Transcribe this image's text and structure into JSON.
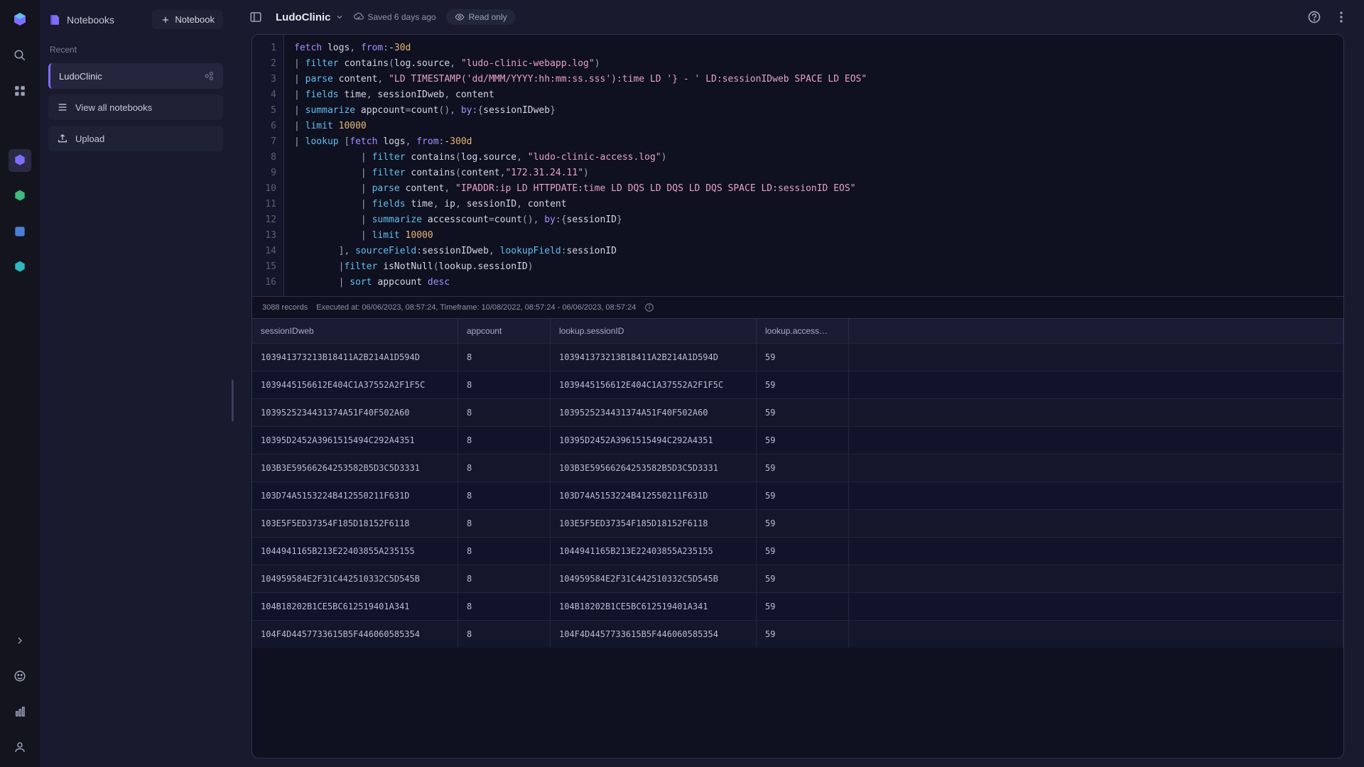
{
  "rail": {
    "items": [
      "logo",
      "search",
      "apps",
      "gap",
      "cube-purple",
      "cube-green",
      "app-blue",
      "hex-teal"
    ],
    "bottom": [
      "expand",
      "smiley",
      "bars",
      "user"
    ]
  },
  "sidebar": {
    "notebooks_label": "Notebooks",
    "new_notebook_label": "Notebook",
    "recent_label": "Recent",
    "current_notebook": "LudoClinic",
    "actions": {
      "view_all": "View all notebooks",
      "upload": "Upload"
    }
  },
  "topbar": {
    "title": "LudoClinic",
    "saved_status": "Saved 6 days ago",
    "readonly_label": "Read only"
  },
  "query": {
    "line_count": 16,
    "lines": [
      [
        [
          "kw",
          "fetch"
        ],
        [
          "id",
          " logs"
        ],
        [
          "op",
          ", "
        ],
        [
          "kw",
          "from"
        ],
        [
          "op",
          ":"
        ],
        [
          "id",
          "-"
        ],
        [
          "num",
          "30d"
        ]
      ],
      [
        [
          "op",
          "| "
        ],
        [
          "fn",
          "filter"
        ],
        [
          "id",
          " contains"
        ],
        [
          "op",
          "("
        ],
        [
          "id",
          "log.source"
        ],
        [
          "op",
          ", "
        ],
        [
          "str",
          "\"ludo-clinic-webapp.log\""
        ],
        [
          "op",
          ")"
        ]
      ],
      [
        [
          "op",
          "| "
        ],
        [
          "fn",
          "parse"
        ],
        [
          "id",
          " content"
        ],
        [
          "op",
          ", "
        ],
        [
          "str",
          "\"LD TIMESTAMP('dd/MMM/YYYY:hh:mm:ss.sss'):time LD '} - ' LD:sessionIDweb SPACE LD EOS\""
        ]
      ],
      [
        [
          "op",
          "| "
        ],
        [
          "fn",
          "fields"
        ],
        [
          "id",
          " time"
        ],
        [
          "op",
          ", "
        ],
        [
          "id",
          "sessionIDweb"
        ],
        [
          "op",
          ", "
        ],
        [
          "id",
          "content"
        ]
      ],
      [
        [
          "op",
          "| "
        ],
        [
          "fn",
          "summarize"
        ],
        [
          "id",
          " appcount"
        ],
        [
          "op",
          "="
        ],
        [
          "id",
          "count"
        ],
        [
          "op",
          "(), "
        ],
        [
          "kw",
          "by"
        ],
        [
          "op",
          ":{"
        ],
        [
          "id",
          "sessionIDweb"
        ],
        [
          "op",
          "}"
        ]
      ],
      [
        [
          "op",
          "| "
        ],
        [
          "fn",
          "limit"
        ],
        [
          "op",
          " "
        ],
        [
          "num",
          "10000"
        ]
      ],
      [
        [
          "op",
          "| "
        ],
        [
          "fn",
          "lookup"
        ],
        [
          "op",
          " ["
        ],
        [
          "kw",
          "fetch"
        ],
        [
          "id",
          " logs"
        ],
        [
          "op",
          ", "
        ],
        [
          "kw",
          "from"
        ],
        [
          "op",
          ":"
        ],
        [
          "id",
          "-"
        ],
        [
          "num",
          "300d"
        ]
      ],
      [
        [
          "op",
          "            | "
        ],
        [
          "fn",
          "filter"
        ],
        [
          "id",
          " contains"
        ],
        [
          "op",
          "("
        ],
        [
          "id",
          "log.source"
        ],
        [
          "op",
          ", "
        ],
        [
          "str",
          "\"ludo-clinic-access.log\""
        ],
        [
          "op",
          ")"
        ]
      ],
      [
        [
          "op",
          "            | "
        ],
        [
          "fn",
          "filter"
        ],
        [
          "id",
          " contains"
        ],
        [
          "op",
          "("
        ],
        [
          "id",
          "content"
        ],
        [
          "op",
          ","
        ],
        [
          "str",
          "\"172.31.24.11\""
        ],
        [
          "op",
          ")"
        ]
      ],
      [
        [
          "op",
          "            | "
        ],
        [
          "fn",
          "parse"
        ],
        [
          "id",
          " content"
        ],
        [
          "op",
          ", "
        ],
        [
          "str",
          "\"IPADDR:ip LD HTTPDATE:time LD DQS LD DQS LD DQS SPACE LD:sessionID EOS\""
        ]
      ],
      [
        [
          "op",
          "            | "
        ],
        [
          "fn",
          "fields"
        ],
        [
          "id",
          " time"
        ],
        [
          "op",
          ", "
        ],
        [
          "id",
          "ip"
        ],
        [
          "op",
          ", "
        ],
        [
          "id",
          "sessionID"
        ],
        [
          "op",
          ", "
        ],
        [
          "id",
          "content"
        ]
      ],
      [
        [
          "op",
          "            | "
        ],
        [
          "fn",
          "summarize"
        ],
        [
          "id",
          " accesscount"
        ],
        [
          "op",
          "="
        ],
        [
          "id",
          "count"
        ],
        [
          "op",
          "(), "
        ],
        [
          "kw",
          "by"
        ],
        [
          "op",
          ":{"
        ],
        [
          "id",
          "sessionID"
        ],
        [
          "op",
          "}"
        ]
      ],
      [
        [
          "op",
          "            | "
        ],
        [
          "fn",
          "limit"
        ],
        [
          "op",
          " "
        ],
        [
          "num",
          "10000"
        ]
      ],
      [
        [
          "op",
          "        ], "
        ],
        [
          "fn",
          "sourceField"
        ],
        [
          "op",
          ":"
        ],
        [
          "id",
          "sessionIDweb"
        ],
        [
          "op",
          ", "
        ],
        [
          "fn",
          "lookupField"
        ],
        [
          "op",
          ":"
        ],
        [
          "id",
          "sessionID"
        ]
      ],
      [
        [
          "op",
          "        |"
        ],
        [
          "fn",
          "filter"
        ],
        [
          "id",
          " isNotNull"
        ],
        [
          "op",
          "("
        ],
        [
          "id",
          "lookup.sessionID"
        ],
        [
          "op",
          ")"
        ]
      ],
      [
        [
          "op",
          "        | "
        ],
        [
          "fn",
          "sort"
        ],
        [
          "id",
          " appcount "
        ],
        [
          "kw",
          "desc"
        ]
      ]
    ]
  },
  "status": {
    "record_count": "3088 records",
    "execution_info": "Executed at: 06/06/2023, 08:57:24, Timeframe: 10/08/2022, 08:57:24 - 06/06/2023, 08:57:24"
  },
  "table": {
    "columns": [
      "sessionIDweb",
      "appcount",
      "lookup.sessionID",
      "lookup.access…",
      ""
    ],
    "rows": [
      [
        "103941373213B18411A2B214A1D594D",
        "8",
        "103941373213B18411A2B214A1D594D",
        "59",
        ""
      ],
      [
        "1039445156612E404C1A37552A2F1F5C",
        "8",
        "1039445156612E404C1A37552A2F1F5C",
        "59",
        ""
      ],
      [
        "1039525234431374A51F40F502A60",
        "8",
        "1039525234431374A51F40F502A60",
        "59",
        ""
      ],
      [
        "10395D2452A3961515494C292A4351",
        "8",
        "10395D2452A3961515494C292A4351",
        "59",
        ""
      ],
      [
        "103B3E59566264253582B5D3C5D3331",
        "8",
        "103B3E59566264253582B5D3C5D3331",
        "59",
        ""
      ],
      [
        "103D74A5153224B412550211F631D",
        "8",
        "103D74A5153224B412550211F631D",
        "59",
        ""
      ],
      [
        "103E5F5ED37354F185D18152F6118",
        "8",
        "103E5F5ED37354F185D18152F6118",
        "59",
        ""
      ],
      [
        "1044941165B213E22403855A235155",
        "8",
        "1044941165B213E22403855A235155",
        "59",
        ""
      ],
      [
        "104959584E2F31C442510332C5D545B",
        "8",
        "104959584E2F31C442510332C5D545B",
        "59",
        ""
      ],
      [
        "104B18202B1CE5BC612519401A341",
        "8",
        "104B18202B1CE5BC612519401A341",
        "59",
        ""
      ],
      [
        "104F4D4457733615B5F446060585354",
        "8",
        "104F4D4457733615B5F446060585354",
        "59",
        ""
      ]
    ]
  }
}
